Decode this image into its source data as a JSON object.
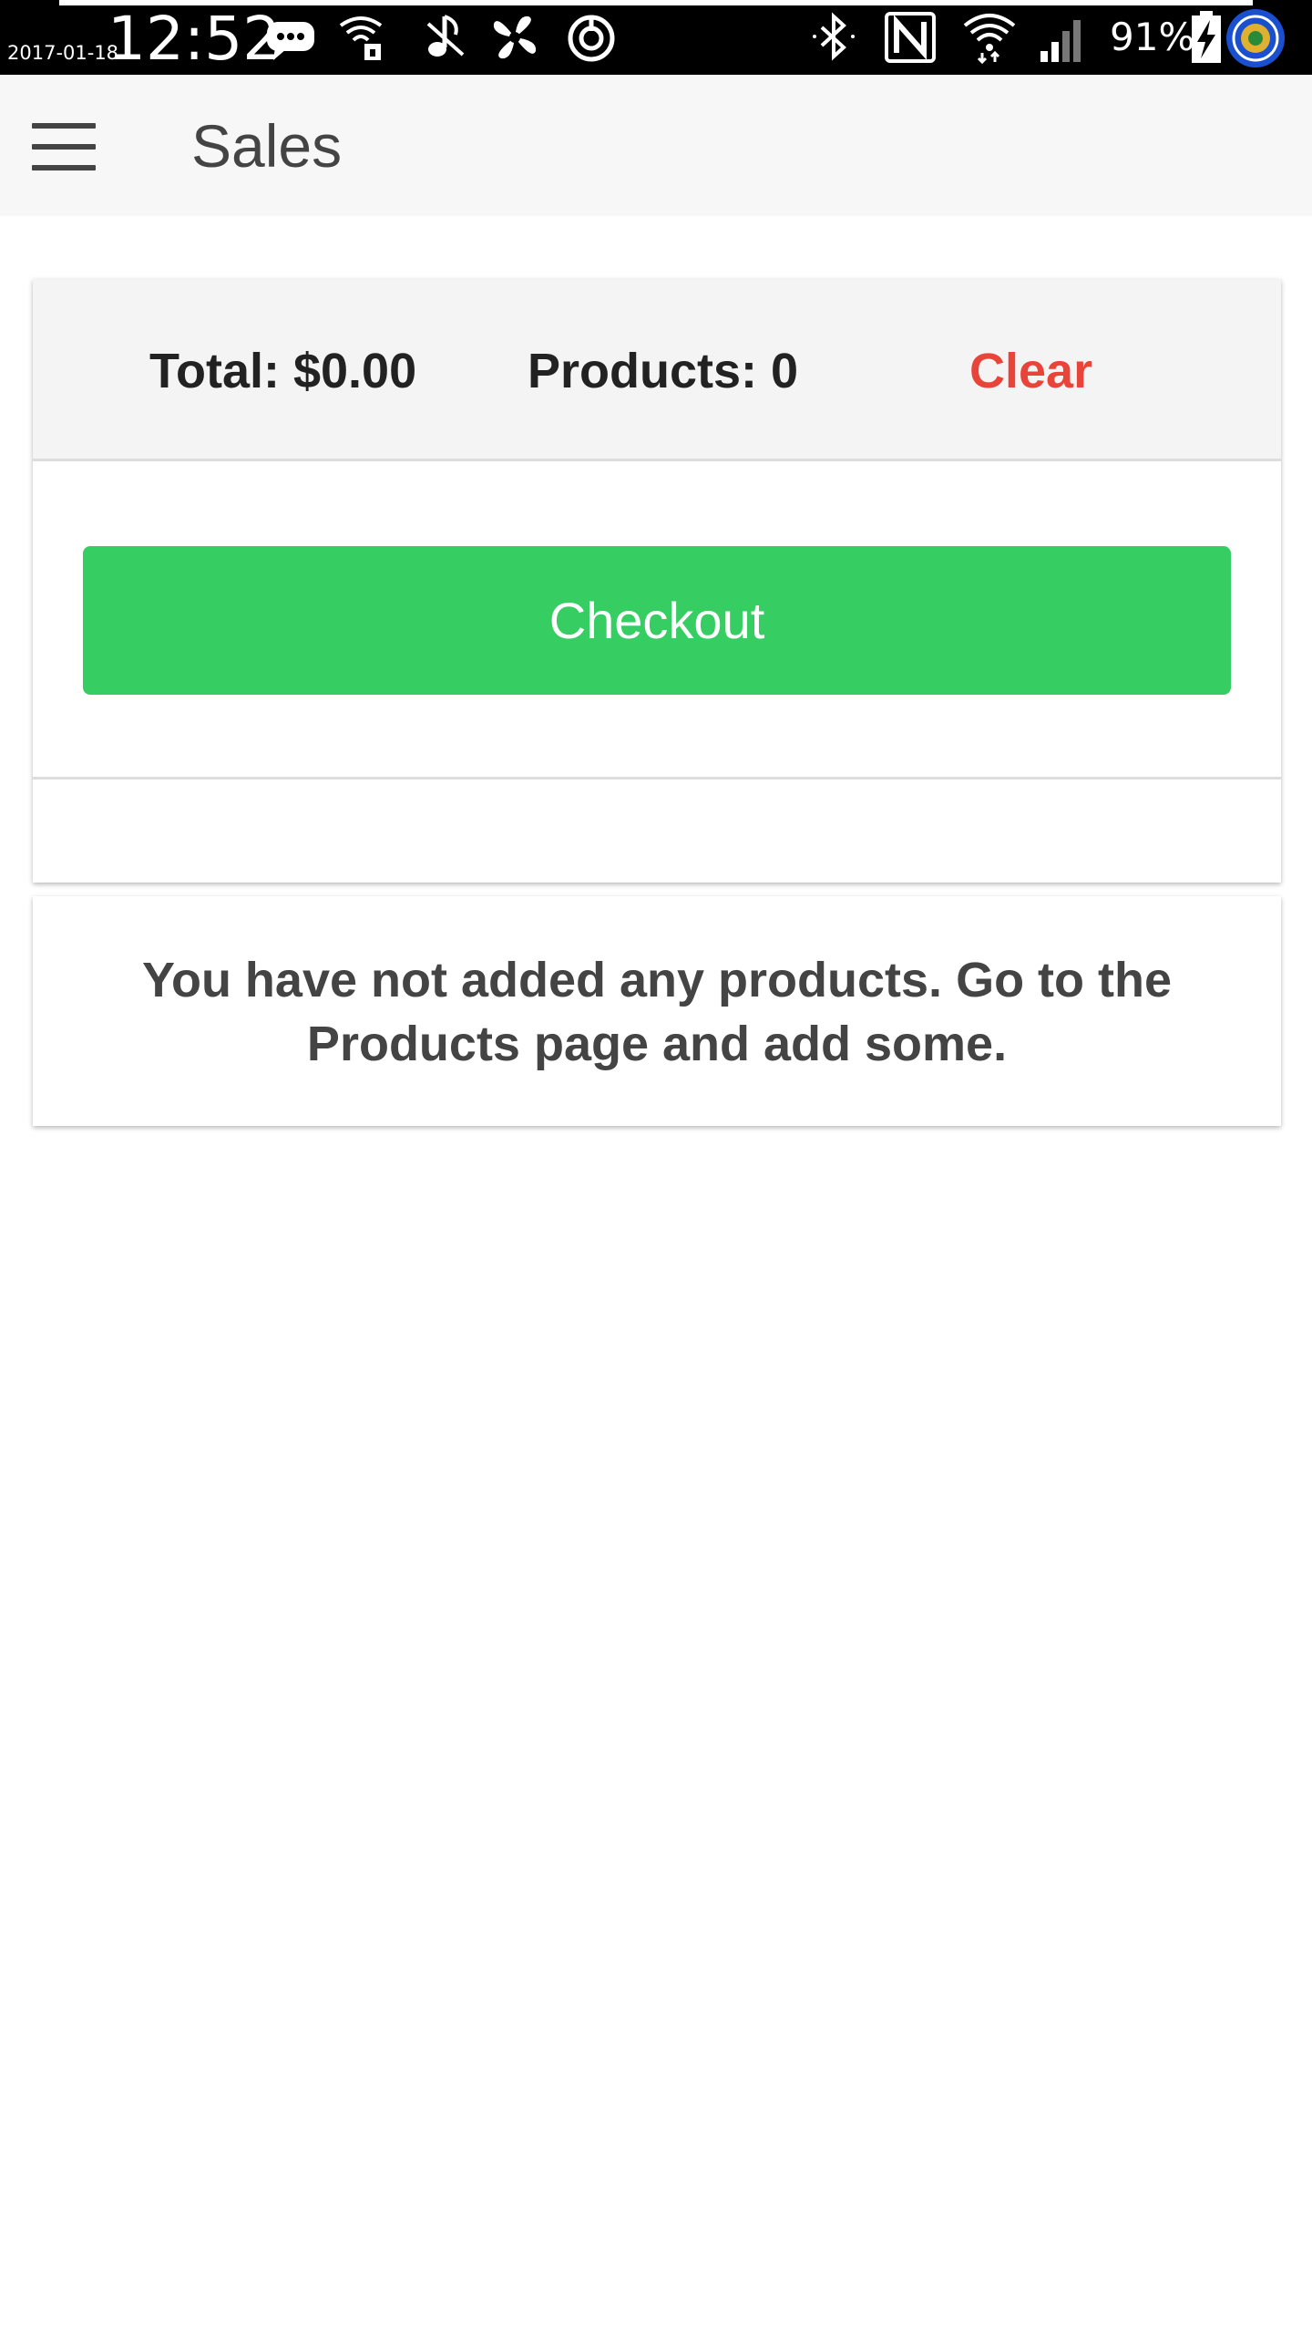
{
  "status_bar": {
    "date": "2017-01-18",
    "time": "12:52",
    "battery_percent": "91%",
    "left_icons": [
      "messages-icon",
      "wifi-hotspot-icon",
      "music-off-icon",
      "fan-icon",
      "sync-icon"
    ],
    "right_icons": [
      "bluetooth-icon",
      "nfc-icon",
      "wifi-icon",
      "cell-signal-icon",
      "battery-charging-icon",
      "app-orb-icon"
    ]
  },
  "app_bar": {
    "menu_icon": "hamburger-menu-icon",
    "title": "Sales"
  },
  "summary": {
    "total_label": "Total: $0.00",
    "products_label": "Products: 0",
    "clear_label": "Clear",
    "checkout_label": "Checkout"
  },
  "empty_state": {
    "message": "You have not added any products. Go to the Products page and add some."
  },
  "colors": {
    "checkout_green": "#36cd62",
    "clear_red": "#e8443a",
    "app_bar_bg": "#f7f7f7",
    "text_dark": "#222222",
    "text_gray": "#444444"
  }
}
